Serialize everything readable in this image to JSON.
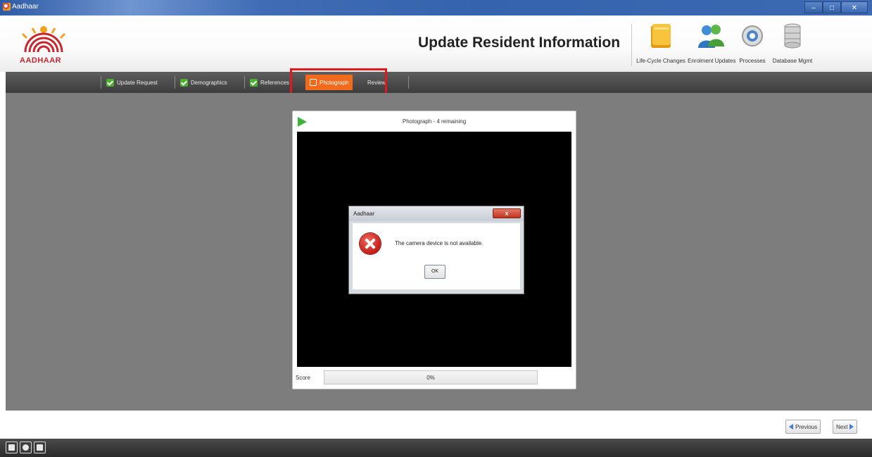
{
  "window": {
    "title": "Aadhaar",
    "controls": {
      "minimize": "–",
      "maximize": "□",
      "close": "✕"
    }
  },
  "header": {
    "logo_text": "AADHAAR",
    "page_title": "Update Resident Information",
    "tools": [
      {
        "label": "Life-Cycle Changes",
        "icon": "folder-icon"
      },
      {
        "label": "Enrolment Updates",
        "icon": "users-icon"
      },
      {
        "label": "Processes",
        "icon": "gear-icon"
      },
      {
        "label": "Database Mgmt",
        "icon": "database-icon"
      }
    ]
  },
  "tabs": [
    {
      "label": "Update Request",
      "state": "done"
    },
    {
      "label": "Demographics",
      "state": "done"
    },
    {
      "label": "References",
      "state": "done"
    },
    {
      "label": "Photograph",
      "state": "active"
    },
    {
      "label": "Review",
      "state": "pending"
    }
  ],
  "photo_panel": {
    "title": "Photograph - 4 remaining",
    "score_label": "Score",
    "score_value": "0%"
  },
  "dialog": {
    "title": "Aadhaar",
    "close_label": "x",
    "message": "The camera device is not available.",
    "ok_label": "OK",
    "icon": "error-icon"
  },
  "navigation": {
    "previous_label": "Previous",
    "next_label": "Next"
  },
  "colors": {
    "active_tab": "#f26b1d",
    "highlight_border": "#e0191f",
    "main_background": "#7d7d7d"
  }
}
